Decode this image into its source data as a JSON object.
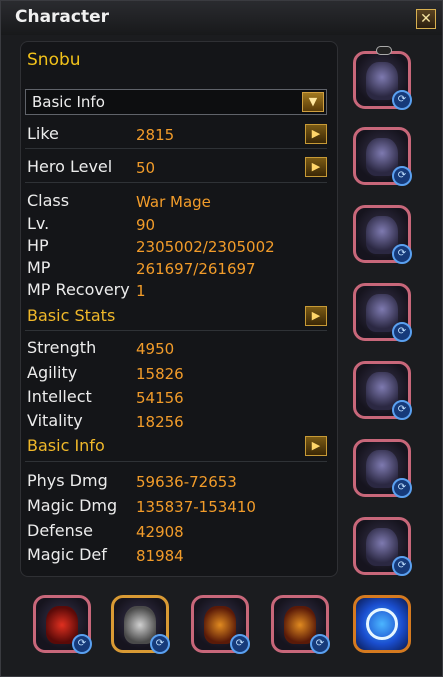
{
  "window": {
    "title": "Character"
  },
  "character": {
    "name": "Snobu"
  },
  "dropdown": {
    "selected": "Basic Info"
  },
  "general": {
    "like_label": "Like",
    "like_value": "2815",
    "hero_label": "Hero Level",
    "hero_value": "50",
    "class_label": "Class",
    "class_value": "War Mage",
    "lv_label": "Lv.",
    "lv_value": "90",
    "hp_label": "HP",
    "hp_value": "2305002/2305002",
    "mp_label": "MP",
    "mp_value": "261697/261697",
    "mprec_label": "MP Recovery",
    "mprec_value": "1"
  },
  "basic_stats": {
    "title": "Basic Stats",
    "items": [
      {
        "label": "Strength",
        "value": "4950"
      },
      {
        "label": "Agility",
        "value": "15826"
      },
      {
        "label": "Intellect",
        "value": "54156"
      },
      {
        "label": "Vitality",
        "value": "18256"
      }
    ]
  },
  "basic_info": {
    "title": "Basic Info",
    "items": [
      {
        "label": "Phys Dmg",
        "value": "59636-72653"
      },
      {
        "label": "Magic Dmg",
        "value": "135837-153410"
      },
      {
        "label": "Defense",
        "value": "42908"
      },
      {
        "label": "Magic Def",
        "value": "81984"
      }
    ]
  },
  "equipment": {
    "right_column": [
      "helmet",
      "shoulders",
      "chest",
      "cloak",
      "legs",
      "weapon",
      "boots"
    ],
    "bottom_row": [
      "necklace",
      "earrings",
      "ring",
      "ring",
      "rune"
    ]
  },
  "colors": {
    "value": "#f29c2a",
    "section": "#f0b82a",
    "name": "#f2c21a",
    "slot_border": "#c8677a"
  }
}
